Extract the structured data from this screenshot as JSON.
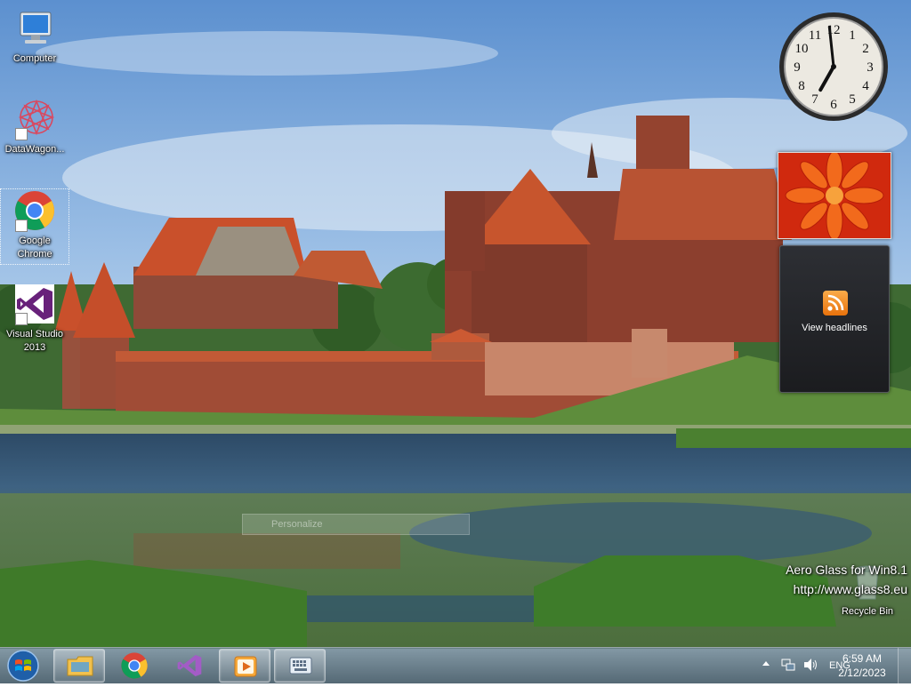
{
  "desktop": {
    "icons": [
      {
        "label": "Computer",
        "icon": "computer-icon"
      },
      {
        "label": "DataWagon...",
        "icon": "datawagon-icon"
      },
      {
        "label": "Google Chrome",
        "icon": "chrome-icon"
      },
      {
        "label": "Visual Studio 2013",
        "icon": "visual-studio-icon"
      }
    ],
    "recycle_bin": {
      "label": "Recycle Bin",
      "icon": "recycle-bin-icon"
    }
  },
  "gadgets": {
    "clock": {
      "time": "6:59",
      "hour": 6,
      "minute": 59
    },
    "slideshow": {
      "image": "orange-flower-photo"
    },
    "feed_headlines": {
      "label": "View headlines",
      "icon": "rss-icon"
    }
  },
  "context_menu_ghost": {
    "label": "Personalize"
  },
  "watermark": {
    "line1": "Aero Glass for Win8.1",
    "line2": "http://www.glass8.eu"
  },
  "taskbar": {
    "start": {
      "icon": "windows-start-icon"
    },
    "pinned": [
      {
        "name": "file-explorer",
        "icon": "folder-icon"
      },
      {
        "name": "google-chrome",
        "icon": "chrome-icon"
      },
      {
        "name": "visual-studio",
        "icon": "visual-studio-icon"
      },
      {
        "name": "media-player",
        "icon": "media-player-icon"
      },
      {
        "name": "on-screen-keyboard",
        "icon": "keyboard-icon"
      }
    ],
    "tray": {
      "language": "ENG",
      "time": "6:59 AM",
      "date": "2/12/2023"
    }
  },
  "colors": {
    "sky": "#6fa3d9",
    "water": "#2f4f6b",
    "brick": "#a8503a",
    "roof": "#c9502b",
    "grass": "#5f8c3a"
  }
}
